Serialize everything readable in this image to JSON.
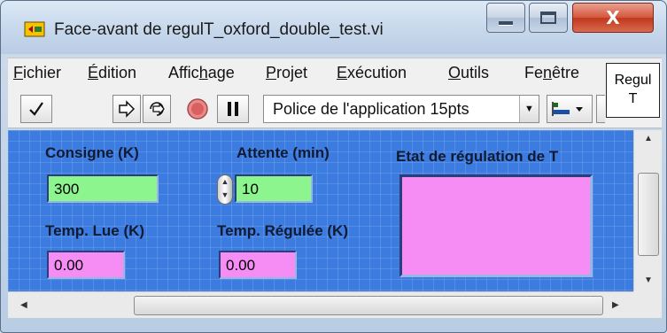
{
  "window": {
    "title": "Face-avant de regulT_oxford_double_test.vi",
    "close_glyph": "X"
  },
  "menu": {
    "items": [
      {
        "pre": "",
        "u": "F",
        "post": "ichier"
      },
      {
        "pre": "",
        "u": "É",
        "post": "dition"
      },
      {
        "pre": "Affic",
        "u": "h",
        "post": "age"
      },
      {
        "pre": "",
        "u": "P",
        "post": "rojet"
      },
      {
        "pre": "",
        "u": "E",
        "post": "xécution"
      },
      {
        "pre": "",
        "u": "O",
        "post": "utils"
      },
      {
        "pre": "Fe",
        "u": "n",
        "post": "être"
      }
    ]
  },
  "tooltip": {
    "line1": "Regul",
    "line2": "T"
  },
  "toolbar": {
    "font_select_value": "Police de l'application 15pts"
  },
  "panel": {
    "consigne_label": "Consigne (K)",
    "consigne_value": "300",
    "attente_label": "Attente (min)",
    "attente_value": "10",
    "etat_label": "Etat de régulation de T",
    "temp_lue_label": "Temp. Lue (K)",
    "temp_lue_value": "0.00",
    "temp_regulee_label": "Temp. Régulée (K)",
    "temp_regulee_value": "0.00"
  },
  "colors": {
    "panel_bg": "#3c7be0",
    "control_green": "#8df58d",
    "indicator_pink": "#f58df5"
  }
}
